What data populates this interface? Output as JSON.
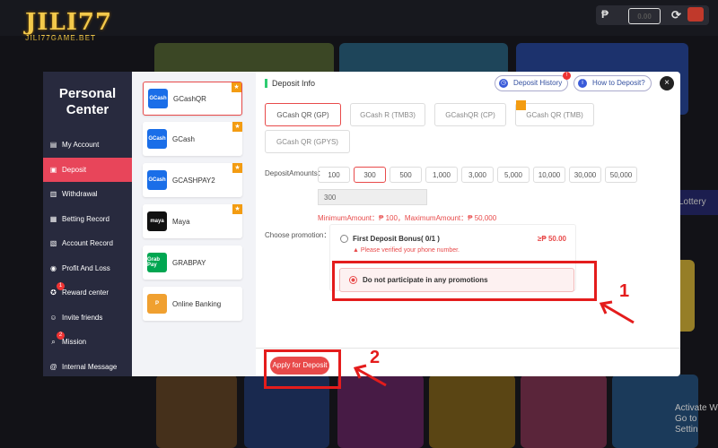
{
  "header": {
    "brand": "JILI77",
    "brand_sub": "JILI77GAME.BET",
    "currency_symbol": "₱",
    "balance": "0.00"
  },
  "background": {
    "lottery_label": "Lottery",
    "activate_line1": "Activate W",
    "activate_line2": "Go to Settin"
  },
  "modal": {
    "title_line1": "Personal",
    "title_line2": "Center",
    "nav": [
      {
        "label": "My Account",
        "icon": "account-icon"
      },
      {
        "label": "Deposit",
        "icon": "deposit-icon",
        "active": true
      },
      {
        "label": "Withdrawal",
        "icon": "withdrawal-icon"
      },
      {
        "label": "Betting Record",
        "icon": "betting-record-icon"
      },
      {
        "label": "Account Record",
        "icon": "account-record-icon"
      },
      {
        "label": "Profit And Loss",
        "icon": "profit-loss-icon"
      },
      {
        "label": "Reward center",
        "icon": "reward-icon",
        "badge": "1"
      },
      {
        "label": "Invite friends",
        "icon": "invite-icon"
      },
      {
        "label": "Mission",
        "icon": "mission-icon",
        "badge": "2"
      },
      {
        "label": "Internal Message",
        "icon": "message-icon"
      }
    ],
    "payments": [
      {
        "label": "GCashQR",
        "icon_text": "GCash",
        "color": "#1a6ee8",
        "selected": true,
        "star": true
      },
      {
        "label": "GCash",
        "icon_text": "GCash",
        "color": "#1a6ee8",
        "star": true
      },
      {
        "label": "GCASHPAY2",
        "icon_text": "GCash",
        "color": "#1a6ee8",
        "star": true
      },
      {
        "label": "Maya",
        "icon_text": "maya",
        "color": "#111111",
        "star": true
      },
      {
        "label": "GRABPAY",
        "icon_text": "Grab Pay",
        "color": "#00a651"
      },
      {
        "label": "Online Banking",
        "icon_text": "P",
        "color": "#f0a030"
      }
    ],
    "deposit_info_title": "Deposit Info",
    "deposit_history_label": "Deposit History",
    "deposit_history_badge": "!",
    "how_to_label": "How to Deposit?",
    "close_label": "×",
    "channels": [
      "GCash QR (GP)",
      "GCash R (TMB3)",
      "GCashQR (CP)",
      "GCash QR (TMB)",
      "GCash QR (GPYS)"
    ],
    "amounts_label": "DepositAmounts：",
    "amounts": [
      "100",
      "300",
      "500",
      "1,000",
      "3,000",
      "5,000",
      "10,000",
      "30,000",
      "50,000"
    ],
    "amount_input_value": "300",
    "minmax_text": "MinimumAmount：₱ 100，MaximumAmount：₱ 50,000",
    "promotion_label": "Choose promotion：",
    "promo1_title": "First Deposit Bonus( 0/1 )",
    "promo1_amount": "≥₱ 50.00",
    "promo1_warning": "Please verified your phone number.",
    "promo2_title": "Do not participate in any promotions",
    "apply_label": "Apply for Deposit"
  },
  "annotations": {
    "num1": "1",
    "num2": "2"
  }
}
